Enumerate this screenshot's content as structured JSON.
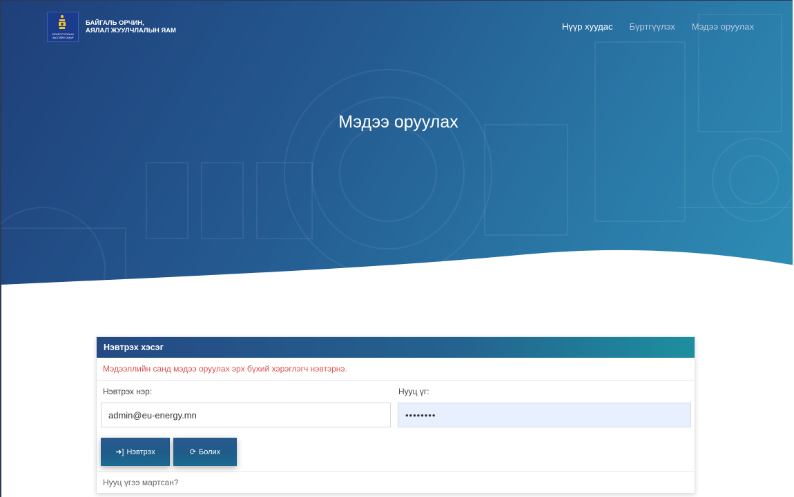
{
  "brand": {
    "ministry_line1": "БАЙГАЛЬ ОРЧИН,",
    "ministry_line2": "АЯЛАЛ ЖУУЛЧЛАЛЫН ЯАМ",
    "emblem_text": "МОНГОЛ УЛСЫН ЗАСГИЙН ГАЗАР"
  },
  "nav": {
    "items": [
      {
        "label": "Нүүр хуудас",
        "active": true
      },
      {
        "label": "Бүртгүүлэх",
        "active": false
      },
      {
        "label": "Мэдээ оруулах",
        "active": false
      }
    ]
  },
  "hero": {
    "title": "Мэдээ оруулах"
  },
  "login": {
    "header": "Нэвтрэх хэсэг",
    "notice": "Мэдээллийн санд мэдээ оруулах эрх бүхий хэрэглэгч нэвтэрнэ.",
    "username_label": "Нэвтрэх нэр:",
    "username_value": "admin@eu-energy.mn",
    "password_label": "Нууц үг:",
    "password_value": "••••••••",
    "login_button": "Нэвтрэх",
    "cancel_button": "Болих",
    "forgot_link": "Нууц үгээ мартсан?"
  },
  "colors": {
    "hero_start": "#1f3f7a",
    "hero_end": "#2e8fb5",
    "notice": "#d9534f",
    "password_bg": "#e8f0fe"
  },
  "icons": {
    "login_button": "sign-in-icon",
    "cancel_button": "refresh-icon"
  }
}
